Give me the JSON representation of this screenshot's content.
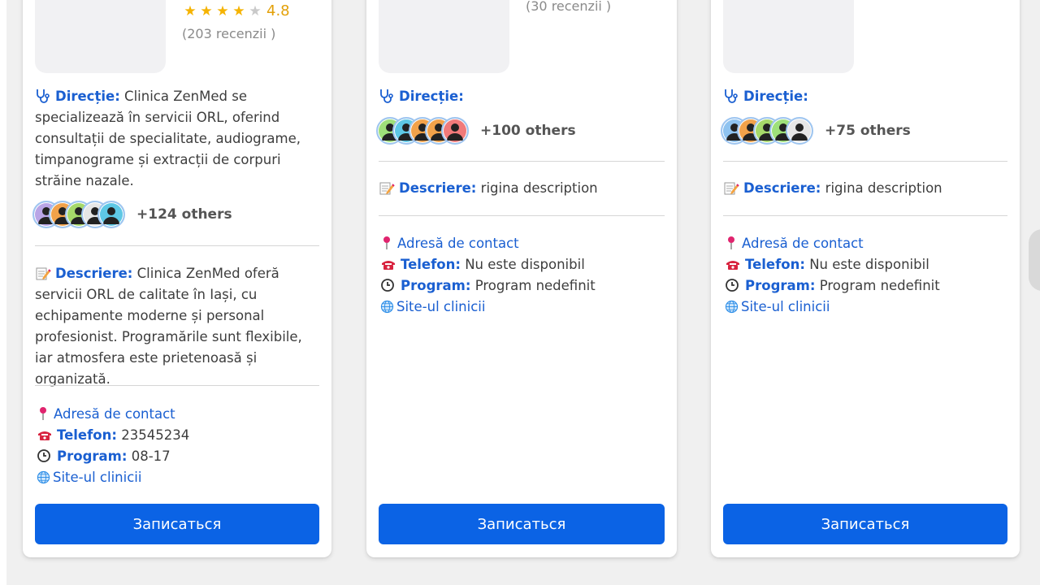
{
  "colors": {
    "accent": "#1a5fd1",
    "button": "#0b63e5",
    "star": "#f5b301",
    "pin": "#e0246e"
  },
  "cards": [
    {
      "rating": "4.8",
      "reviews": "(203 recenzii )",
      "direction_label": "Direcție:",
      "direction_text": "Clinica ZenMed se specializează în servicii ORL, oferind consultații de specialitate, audiograme, timpanograme și extracții de corpuri străine nazale.",
      "others": "+124 others",
      "avatar_colors": [
        "#b9a5e6",
        "#f2a24a",
        "#a6d96a",
        "#e6e6e6",
        "#5ec8e5"
      ],
      "description_label": "Descriere:",
      "description_text": "Clinica ZenMed oferă servicii ORL de calitate în Iași, cu echipamente moderne și personal profesionist. Programările sunt flexibile, iar atmosfera este prietenoasă și organizată.",
      "contact_link": "Adresă de contact",
      "phone_label": "Telefon:",
      "phone_value": "23545234",
      "schedule_label": "Program:",
      "schedule_value": "08-17",
      "site_link": "Site-ul clinicii",
      "button": "Записаться"
    },
    {
      "reviews": "(30 recenzii )",
      "direction_label": "Direcție:",
      "others": "+100 others",
      "avatar_colors": [
        "#9ee07a",
        "#5ec8e5",
        "#f2a24a",
        "#f2a24a",
        "#f07a7a"
      ],
      "description_label": "Descriere:",
      "description_text": "rigina description",
      "contact_link": "Adresă de contact",
      "phone_label": "Telefon:",
      "phone_value": "Nu este disponibil",
      "schedule_label": "Program:",
      "schedule_value": "Program nedefinit",
      "site_link": "Site-ul clinicii",
      "button": "Записаться"
    },
    {
      "direction_label": "Direcție:",
      "others": "+75 others",
      "avatar_colors": [
        "#8fc3f0",
        "#f2a24a",
        "#a6d96a",
        "#9ee07a",
        "#e6e6e6"
      ],
      "description_label": "Descriere:",
      "description_text": "rigina description",
      "contact_link": "Adresă de contact",
      "phone_label": "Telefon:",
      "phone_value": "Nu este disponibil",
      "schedule_label": "Program:",
      "schedule_value": "Program nedefinit",
      "site_link": "Site-ul clinicii",
      "button": "Записаться"
    }
  ]
}
